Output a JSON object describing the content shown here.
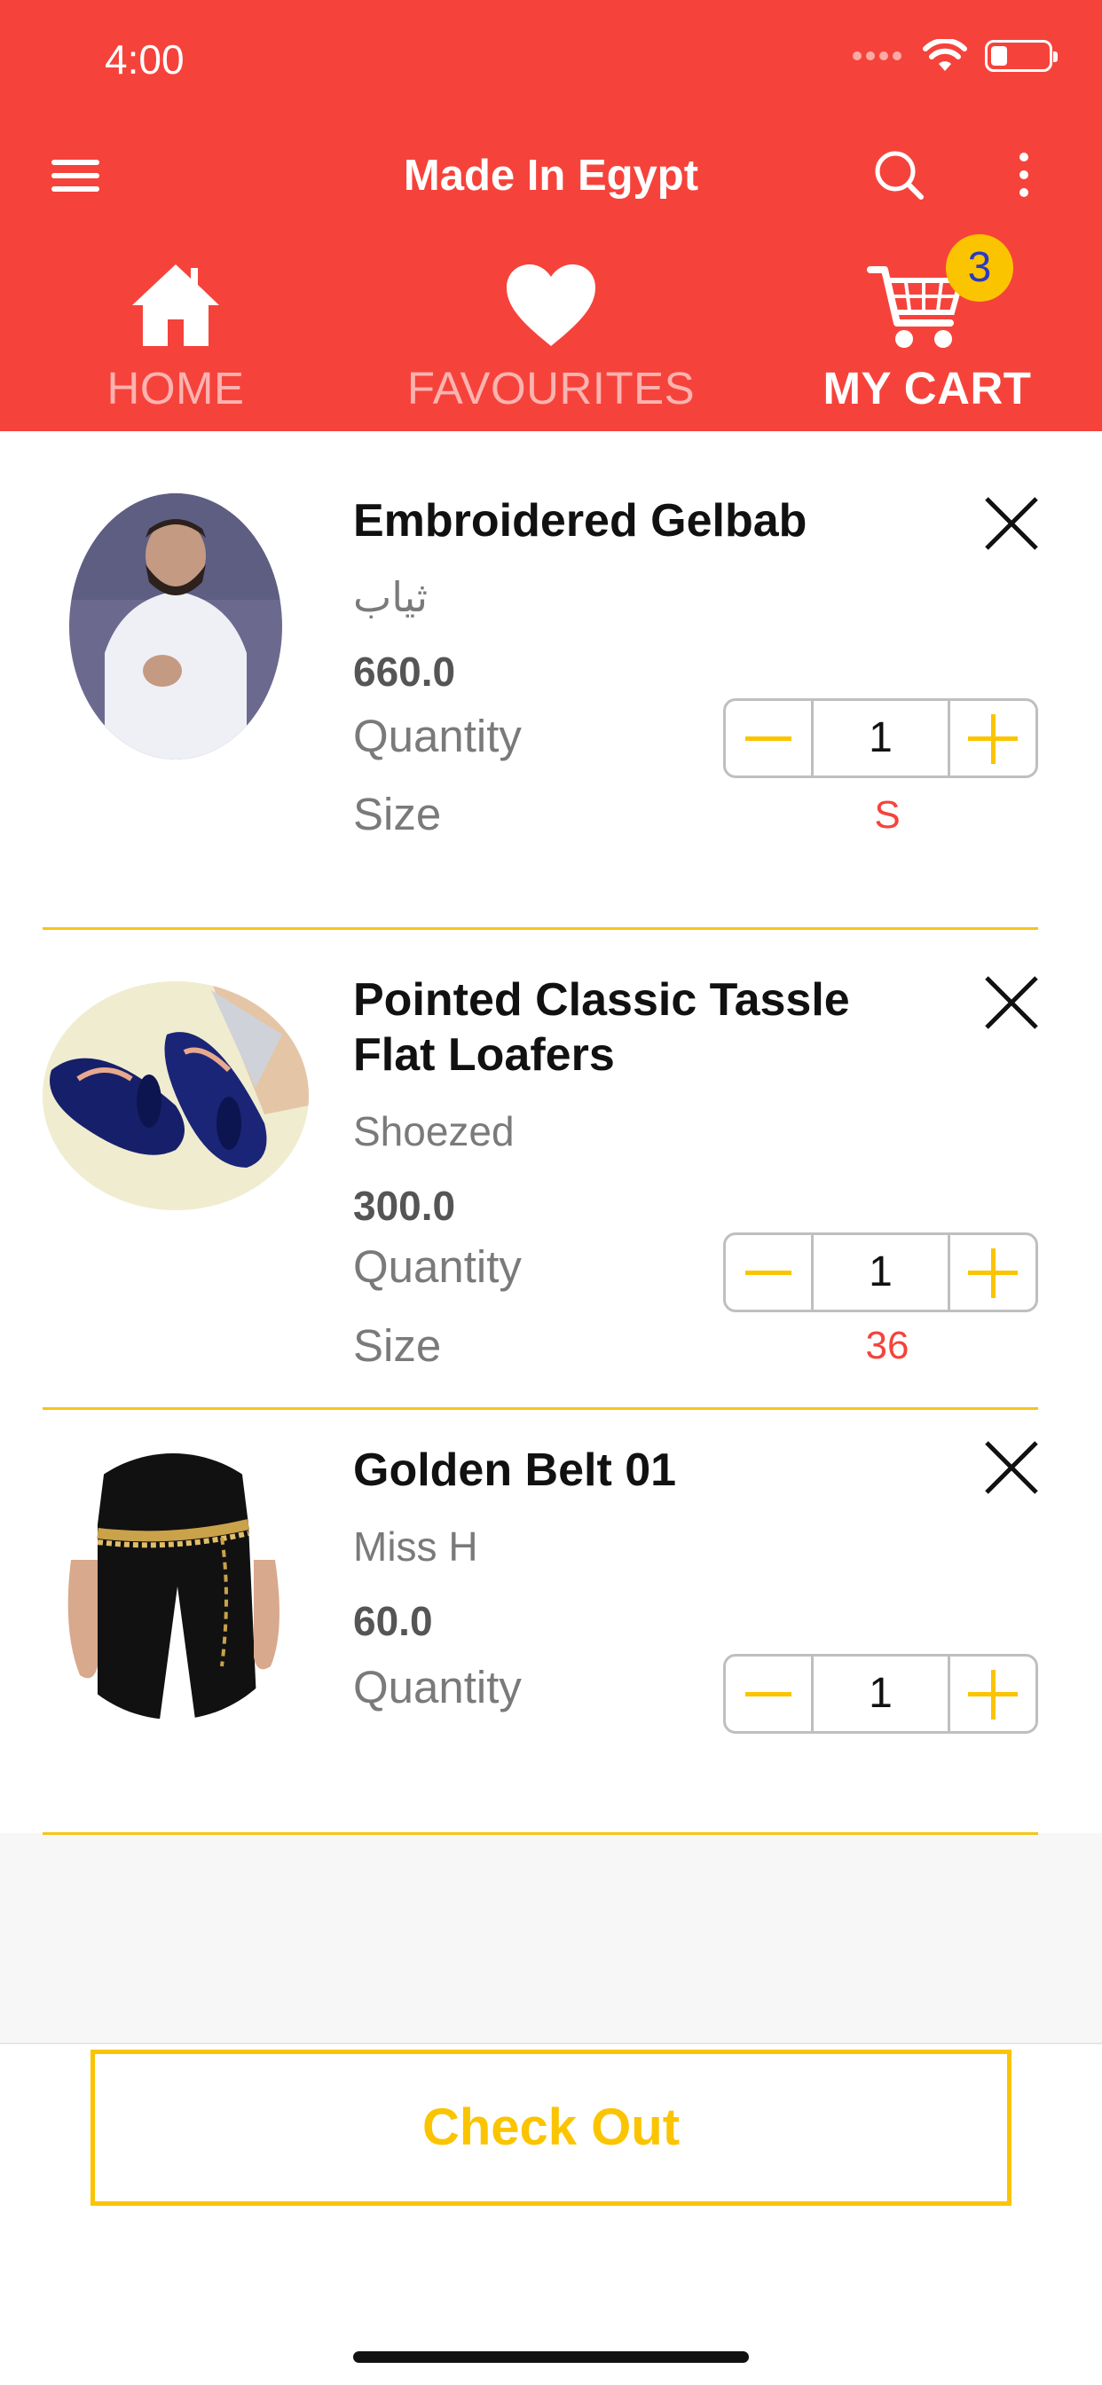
{
  "status_bar": {
    "time": "4:00"
  },
  "app_bar": {
    "title": "Made In Egypt"
  },
  "tabs": [
    {
      "label": "HOME",
      "icon": "home-icon",
      "active": false
    },
    {
      "label": "FAVOURITES",
      "icon": "heart-icon",
      "active": false
    },
    {
      "label": "MY CART",
      "icon": "cart-icon",
      "active": true,
      "badge": "3"
    }
  ],
  "cart": {
    "items": [
      {
        "title": "Embroidered Gelbab",
        "brand": "ثياب",
        "price": "660.0",
        "quantity_label": "Quantity",
        "quantity": "1",
        "size_label": "Size",
        "size": "S"
      },
      {
        "title": "Pointed Classic Tassle Flat Loafers",
        "brand": "Shoezed",
        "price": "300.0",
        "quantity_label": "Quantity",
        "quantity": "1",
        "size_label": "Size",
        "size": "36"
      },
      {
        "title": "Golden Belt 01",
        "brand": "Miss H",
        "price": "60.0",
        "quantity_label": "Quantity",
        "quantity": "1"
      }
    ]
  },
  "checkout_label": "Check Out",
  "colors": {
    "primary": "#f5433b",
    "accent": "#fbc400",
    "badge_text": "#2b3ac2"
  }
}
